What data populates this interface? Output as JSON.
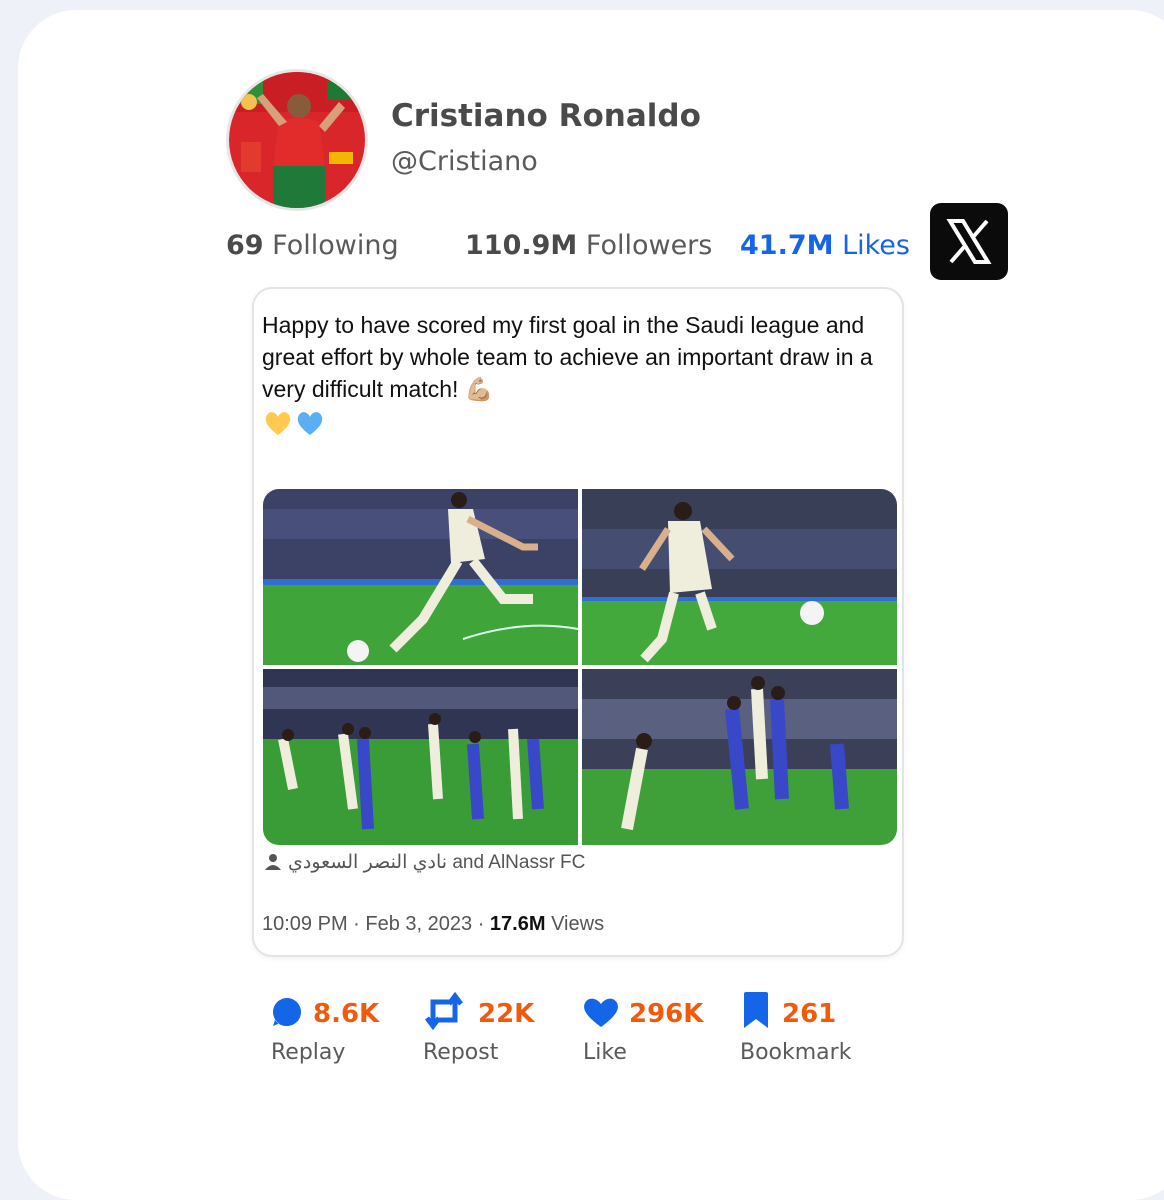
{
  "profile": {
    "name": "Cristiano Ronaldo",
    "handle": "@Cristiano"
  },
  "stats": {
    "following": {
      "value": "69",
      "label": "Following"
    },
    "followers": {
      "value": "110.9M",
      "label": "Followers"
    },
    "likes": {
      "value": "41.7M",
      "label": "Likes"
    }
  },
  "platform_icon": "x-logo-icon",
  "tweet": {
    "text": "Happy to have scored my first goal in the Saudi league and great effort by whole team to achieve an important draw in a very difficult match! 💪🏼",
    "emojis": "💛💙",
    "tagged": "نادي النصر السعودي and AlNassr FC",
    "time": "10:09 PM",
    "date": "Feb 3, 2023",
    "views_count": "17.6M",
    "views_label": "Views"
  },
  "actions": [
    {
      "icon": "reply-icon",
      "count": "8.6K",
      "label": "Replay"
    },
    {
      "icon": "repost-icon",
      "count": "22K",
      "label": "Repost"
    },
    {
      "icon": "heart-icon",
      "count": "296K",
      "label": "Like"
    },
    {
      "icon": "bookmark-icon",
      "count": "261",
      "label": "Bookmark"
    }
  ],
  "colors": {
    "accent": "#1565e8",
    "count": "#f05a0c",
    "x_logo_bg": "#0b0b0b"
  }
}
